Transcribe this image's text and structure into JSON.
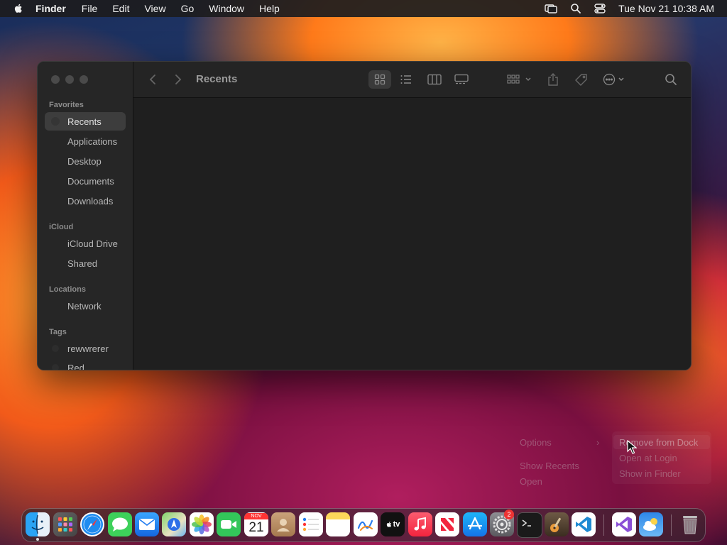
{
  "menubar": {
    "items": [
      "Finder",
      "File",
      "Edit",
      "View",
      "Go",
      "Window",
      "Help"
    ],
    "clock": "Tue Nov 21  10:38 AM"
  },
  "finder": {
    "title": "Recents",
    "sidebar": {
      "favorites_header": "Favorites",
      "favorites": [
        "Recents",
        "Applications",
        "Desktop",
        "Documents",
        "Downloads"
      ],
      "icloud_header": "iCloud",
      "icloud": [
        "iCloud Drive",
        "Shared"
      ],
      "locations_header": "Locations",
      "locations": [
        "Network"
      ],
      "tags_header": "Tags",
      "tags": [
        "rewwrerer",
        "Red"
      ]
    }
  },
  "context_menu": {
    "options": "Options",
    "show_recents": "Show Recents",
    "open": "Open",
    "submenu": [
      "Remove from Dock",
      "Open at Login",
      "Show in Finder"
    ]
  },
  "dock": {
    "calendar_month": "NOV",
    "calendar_day": "21",
    "tv_label": "tv",
    "settings_badge": "2"
  },
  "colors": {
    "menubar_bg": "#1c1c1e",
    "window_bg": "#1f1f1f",
    "sidebar_bg": "#262626",
    "selection": "#3d3d3d"
  }
}
